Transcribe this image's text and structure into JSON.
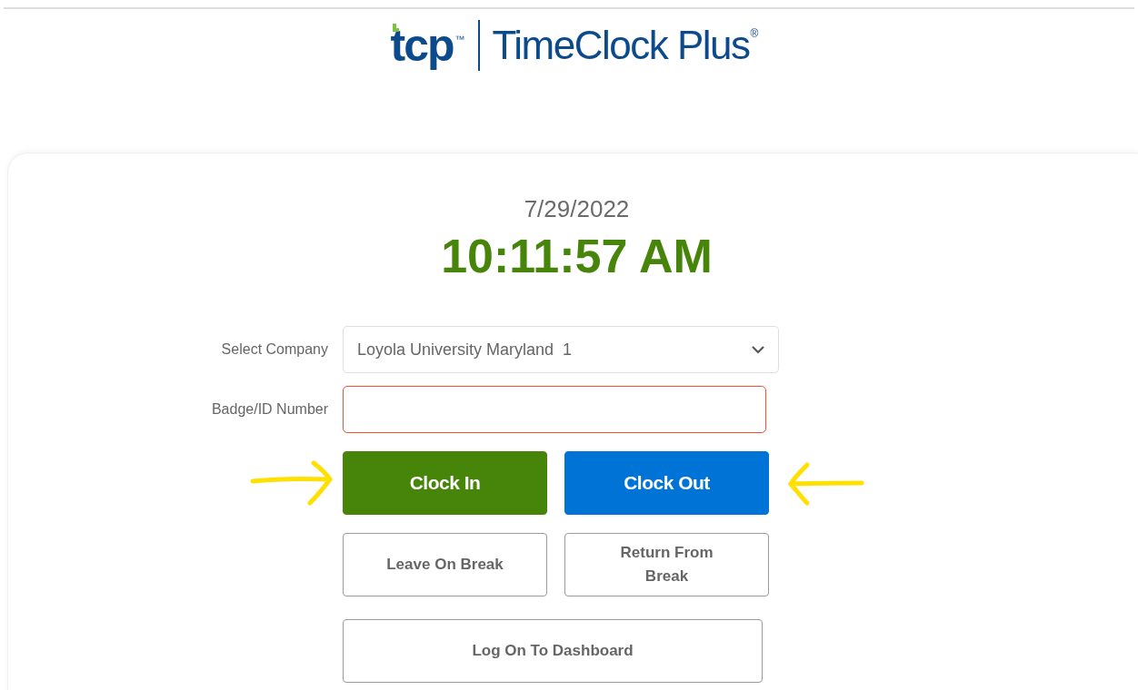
{
  "logo": {
    "mark": "tcp",
    "trademark": "™",
    "name": "TimeClock Plus",
    "registered": "®"
  },
  "clock": {
    "date": "7/29/2022",
    "time": "10:11:57 AM"
  },
  "form": {
    "company": {
      "label": "Select Company",
      "value": "Loyola University Maryland  1"
    },
    "badge": {
      "label": "Badge/ID Number",
      "invalid": true
    }
  },
  "buttons": [
    [
      {
        "label": "Clock In",
        "kind": "green",
        "arrow_before": true,
        "arrow_after": false
      },
      {
        "label": "Clock Out",
        "kind": "blue",
        "arrow_before": false,
        "arrow_after": true
      }
    ],
    [
      {
        "label": "Leave On Break",
        "kind": "outline",
        "arrow_before": false,
        "arrow_after": false
      },
      {
        "label": "Return From Break",
        "kind": "outline",
        "arrow_before": false,
        "arrow_after": false
      }
    ],
    [
      {
        "label": "Log On To Dashboard",
        "kind": "outline",
        "arrow_before": false,
        "arrow_after": false
      }
    ]
  ]
}
